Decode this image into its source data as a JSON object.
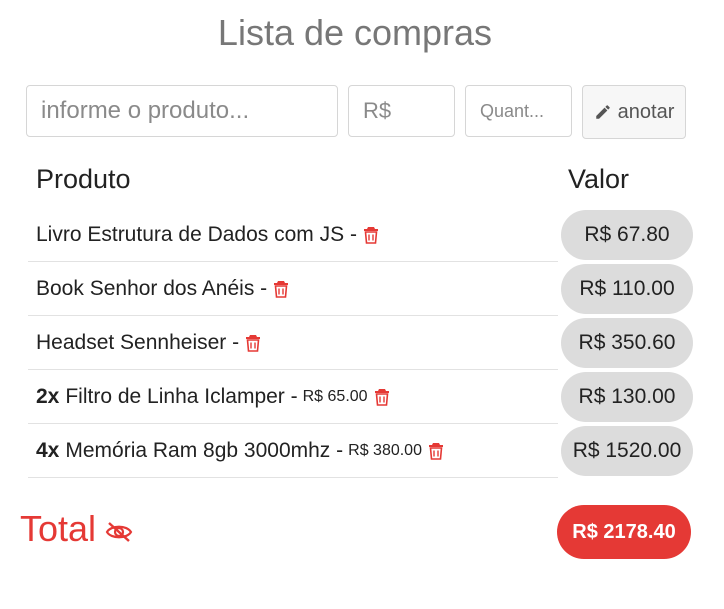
{
  "app": {
    "title": "Lista de compras"
  },
  "form": {
    "produto_placeholder": "informe o produto...",
    "preco_placeholder": "R$",
    "quant_placeholder": "Quant...",
    "anotar_label": "anotar",
    "anotar_icon": "pencil-icon"
  },
  "table": {
    "col_produto": "Produto",
    "col_valor": "Valor",
    "rows": [
      {
        "qty": "",
        "name": "Livro Estrutura de Dados com JS -",
        "unit": "",
        "valor": "R$ 67.80"
      },
      {
        "qty": "",
        "name": "Book Senhor dos Anéis -",
        "unit": "",
        "valor": "R$ 110.00"
      },
      {
        "qty": "",
        "name": "Headset Sennheiser -",
        "unit": "",
        "valor": "R$ 350.60"
      },
      {
        "qty": "2x",
        "name": "Filtro de Linha Iclamper -",
        "unit": "R$ 65.00",
        "valor": "R$ 130.00"
      },
      {
        "qty": "4x",
        "name": "Memória Ram 8gb 3000mhz -",
        "unit": "R$ 380.00",
        "valor": "R$ 1520.00"
      }
    ]
  },
  "total": {
    "label": "Total",
    "value": "R$ 2178.40",
    "icon": "eye-slash-icon"
  },
  "colors": {
    "accent": "#e53935",
    "pill_bg": "#dcdcdc",
    "title": "#777777"
  }
}
